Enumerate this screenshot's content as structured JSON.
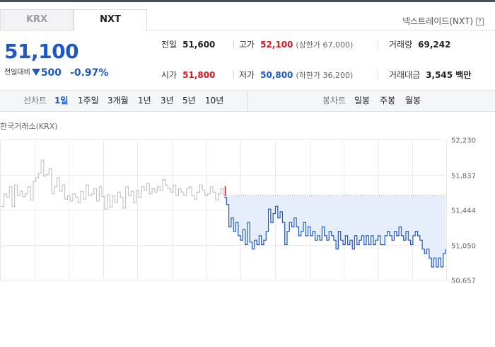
{
  "tabs": [
    {
      "label": "KRX",
      "active": false
    },
    {
      "label": "NXT",
      "active": true
    }
  ],
  "nxt_link": "넥스트레이드(NXT)",
  "help_icon": "?",
  "price": {
    "current": "51,100",
    "change_label": "전일대비",
    "change_abs": "500",
    "change_pct": "-0.97%",
    "direction": "down",
    "color": "#1e58c6"
  },
  "stats": {
    "prev_close": {
      "label": "전일",
      "value": "51,600"
    },
    "high": {
      "label": "고가",
      "value": "52,100",
      "sub": "(상한가 67,000)"
    },
    "volume": {
      "label": "거래량",
      "value": "69,242"
    },
    "open": {
      "label": "시가",
      "value": "51,800"
    },
    "low": {
      "label": "저가",
      "value": "50,800",
      "sub": "(하한가 36,200)"
    },
    "amount": {
      "label": "거래대금",
      "value": "3,545 백만"
    }
  },
  "toolbar": {
    "line_label": "선차트",
    "line_periods": [
      "1일",
      "1주일",
      "3개월",
      "1년",
      "3년",
      "5년",
      "10년"
    ],
    "line_active": "1일",
    "candle_label": "봉차트",
    "candle_periods": [
      "일봉",
      "주봉",
      "월봉"
    ]
  },
  "market_label": "한국거래소(KRX)",
  "colors": {
    "up": "#e0161e",
    "down": "#1e58c6",
    "accent": "#1e58c6"
  },
  "chart_data": {
    "type": "line",
    "ylim": [
      50657,
      52230
    ],
    "yticks": [
      "52,230",
      "51,837",
      "51,444",
      "51,050",
      "50,657"
    ],
    "grid": true,
    "reference_value": 51600,
    "series": [
      {
        "values": [
          51480,
          51620,
          51580,
          51700,
          51480,
          51720,
          51600,
          51650,
          51590,
          51620,
          51700,
          51550,
          51760,
          51800,
          51850,
          52000,
          51820,
          51840,
          51900,
          51620,
          51700,
          51800,
          51650,
          51720,
          51560,
          51600,
          51540,
          51620,
          51580,
          51520,
          51650,
          51560,
          51720,
          51600,
          51620,
          51680,
          51540,
          51700,
          51590,
          51450,
          51610,
          51470,
          51600,
          51520,
          51640,
          51580,
          51460,
          51700,
          51600,
          51650,
          51520,
          51660,
          51580,
          51700,
          51660,
          51740,
          51620,
          51680,
          51640,
          51700,
          51660,
          51780,
          51720,
          51680,
          51640,
          51720,
          51600,
          51680,
          51640,
          51600,
          51680,
          51700,
          51600,
          51560,
          51640,
          51720,
          51660,
          51600,
          51620,
          51700,
          51640,
          51550,
          51620,
          51680,
          51600
        ]
      },
      {
        "values": [
          51580,
          51500,
          51250,
          51350,
          51200,
          51300,
          51150,
          51100,
          51220,
          51050,
          51300,
          51080,
          51000,
          51100,
          51050,
          51150,
          51050,
          51100,
          51200,
          51450,
          51300,
          51400,
          51480,
          51350,
          51420,
          51300,
          51050,
          51200,
          51300,
          51250,
          51350,
          51250,
          51150,
          51200,
          51300,
          51150,
          51250,
          51150,
          51200,
          51100,
          51150,
          51100,
          51250,
          51150,
          51100,
          51200,
          51150,
          51100,
          51000,
          51200,
          51100,
          51050,
          51150,
          51050,
          51100,
          51000,
          51150,
          51050,
          51100,
          51150,
          51050,
          51150,
          51050,
          51150,
          51050,
          51100,
          51150,
          51050,
          51050,
          51150,
          51200,
          51150,
          51100,
          51200,
          51150,
          51250,
          51150,
          51100,
          51200,
          51100,
          51050,
          51150,
          51200,
          51150,
          51100,
          51000,
          50950,
          51000,
          50900,
          50800,
          50900,
          50800,
          50900,
          50800,
          50950,
          51000
        ]
      }
    ]
  }
}
